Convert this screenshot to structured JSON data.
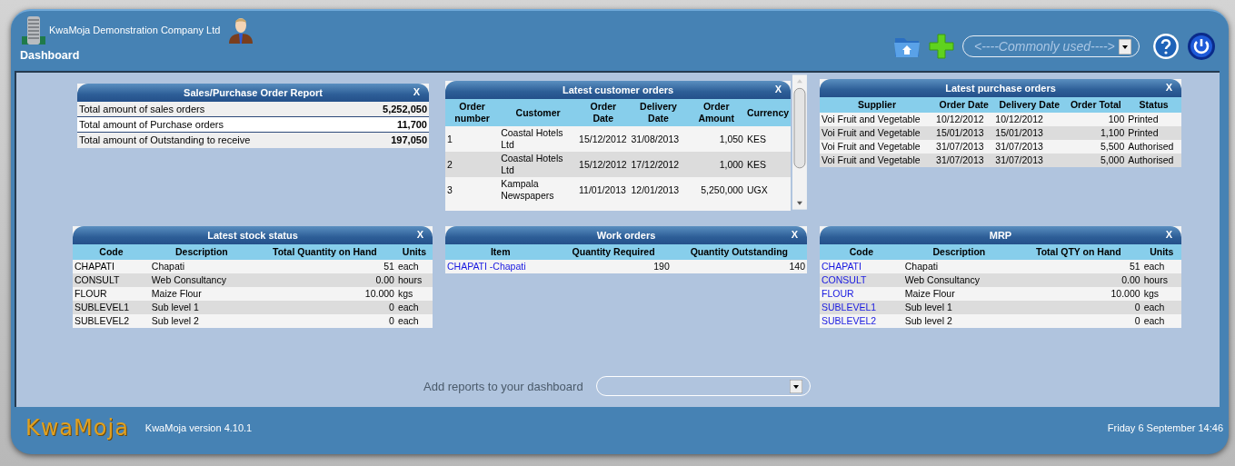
{
  "header": {
    "company": "KwaMoja Demonstration Company Ltd",
    "page_title": "Dashboard",
    "shortcut_select": {
      "placeholder": "<----Commonly used---->"
    }
  },
  "panels": [
    {
      "title": "Sales/Purchase Order Report",
      "close": "X",
      "kind": "summary",
      "rows": [
        {
          "cells": [
            "Total amount of sales orders",
            "5,252,050"
          ]
        },
        {
          "cells": [
            "Total amount of Purchase orders",
            "11,700"
          ]
        },
        {
          "cells": [
            "Total amount of Outstanding to receive",
            "197,050"
          ]
        }
      ]
    },
    {
      "title": "Latest customer orders",
      "close": "X",
      "kind": "table",
      "scrollable": true,
      "columns": [
        {
          "label": "Order number",
          "kind": "text"
        },
        {
          "label": "Customer",
          "kind": "text"
        },
        {
          "label": "Order Date",
          "kind": "text"
        },
        {
          "label": "Delivery Date",
          "kind": "text"
        },
        {
          "label": "Order Amount",
          "kind": "number"
        },
        {
          "label": "Currency",
          "kind": "text"
        }
      ],
      "rows": [
        {
          "cells": [
            "1",
            "Coastal Hotels Ltd",
            "15/12/2012",
            "31/08/2013",
            "1,050",
            "KES"
          ]
        },
        {
          "cells": [
            "2",
            "Coastal Hotels Ltd",
            "15/12/2012",
            "17/12/2012",
            "1,000",
            "KES"
          ]
        },
        {
          "cells": [
            "3",
            "Kampala Newspapers",
            "11/01/2013",
            "12/01/2013",
            "5,250,000",
            "UGX"
          ]
        }
      ]
    },
    {
      "title": "Latest purchase orders",
      "close": "X",
      "kind": "table",
      "columns": [
        {
          "label": "Supplier",
          "kind": "text"
        },
        {
          "label": "Order Date",
          "kind": "text"
        },
        {
          "label": "Delivery Date",
          "kind": "text"
        },
        {
          "label": "Order Total",
          "kind": "number"
        },
        {
          "label": "Status",
          "kind": "text"
        }
      ],
      "rows": [
        {
          "cells": [
            "Voi Fruit and Vegetable",
            "10/12/2012",
            "10/12/2012",
            "100",
            "Printed"
          ]
        },
        {
          "cells": [
            "Voi Fruit and Vegetable",
            "15/01/2013",
            "15/01/2013",
            "1,100",
            "Printed"
          ]
        },
        {
          "cells": [
            "Voi Fruit and Vegetable",
            "31/07/2013",
            "31/07/2013",
            "5,500",
            "Authorised"
          ]
        },
        {
          "cells": [
            "Voi Fruit and Vegetable",
            "31/07/2013",
            "31/07/2013",
            "5,000",
            "Authorised"
          ]
        }
      ]
    },
    {
      "title": "Latest stock status",
      "close": "X",
      "kind": "table",
      "columns": [
        {
          "label": "Code",
          "kind": "text"
        },
        {
          "label": "Description",
          "kind": "text"
        },
        {
          "label": "Total Quantity on Hand",
          "kind": "number"
        },
        {
          "label": "Units",
          "kind": "text"
        }
      ],
      "rows": [
        {
          "cells": [
            "CHAPATI",
            "Chapati",
            "51",
            "each"
          ]
        },
        {
          "cells": [
            "CONSULT",
            "Web Consultancy",
            "0.00",
            "hours"
          ]
        },
        {
          "cells": [
            "FLOUR",
            "Maize Flour",
            "10.000",
            "kgs"
          ]
        },
        {
          "cells": [
            "SUBLEVEL1",
            "Sub level 1",
            "0",
            "each"
          ]
        },
        {
          "cells": [
            "SUBLEVEL2",
            "Sub level 2",
            "0",
            "each"
          ]
        }
      ]
    },
    {
      "title": "Work orders",
      "close": "X",
      "kind": "table",
      "columns": [
        {
          "label": "Item",
          "kind": "link"
        },
        {
          "label": "Quantity Required",
          "kind": "number"
        },
        {
          "label": "Quantity Outstanding",
          "kind": "number"
        }
      ],
      "rows": [
        {
          "cells": [
            "CHAPATI -Chapati",
            "190",
            "140"
          ]
        }
      ]
    },
    {
      "title": "MRP",
      "close": "X",
      "kind": "table",
      "columns": [
        {
          "label": "Code",
          "kind": "link"
        },
        {
          "label": "Description",
          "kind": "text"
        },
        {
          "label": "Total QTY on Hand",
          "kind": "number"
        },
        {
          "label": "Units",
          "kind": "text"
        }
      ],
      "rows": [
        {
          "cells": [
            "CHAPATI",
            "Chapati",
            "51",
            "each"
          ]
        },
        {
          "cells": [
            "CONSULT",
            "Web Consultancy",
            "0.00",
            "hours"
          ]
        },
        {
          "cells": [
            "FLOUR",
            "Maize Flour",
            "10.000",
            "kgs"
          ]
        },
        {
          "cells": [
            "SUBLEVEL1",
            "Sub level 1",
            "0",
            "each"
          ]
        },
        {
          "cells": [
            "SUBLEVEL2",
            "Sub level 2",
            "0",
            "each"
          ]
        }
      ]
    }
  ],
  "add_reports": {
    "label": "Add reports to your dashboard"
  },
  "footer": {
    "logo": "KwaMoja",
    "version": "KwaMoja version 4.10.1",
    "datetime": "Friday 6 September 14:46"
  }
}
